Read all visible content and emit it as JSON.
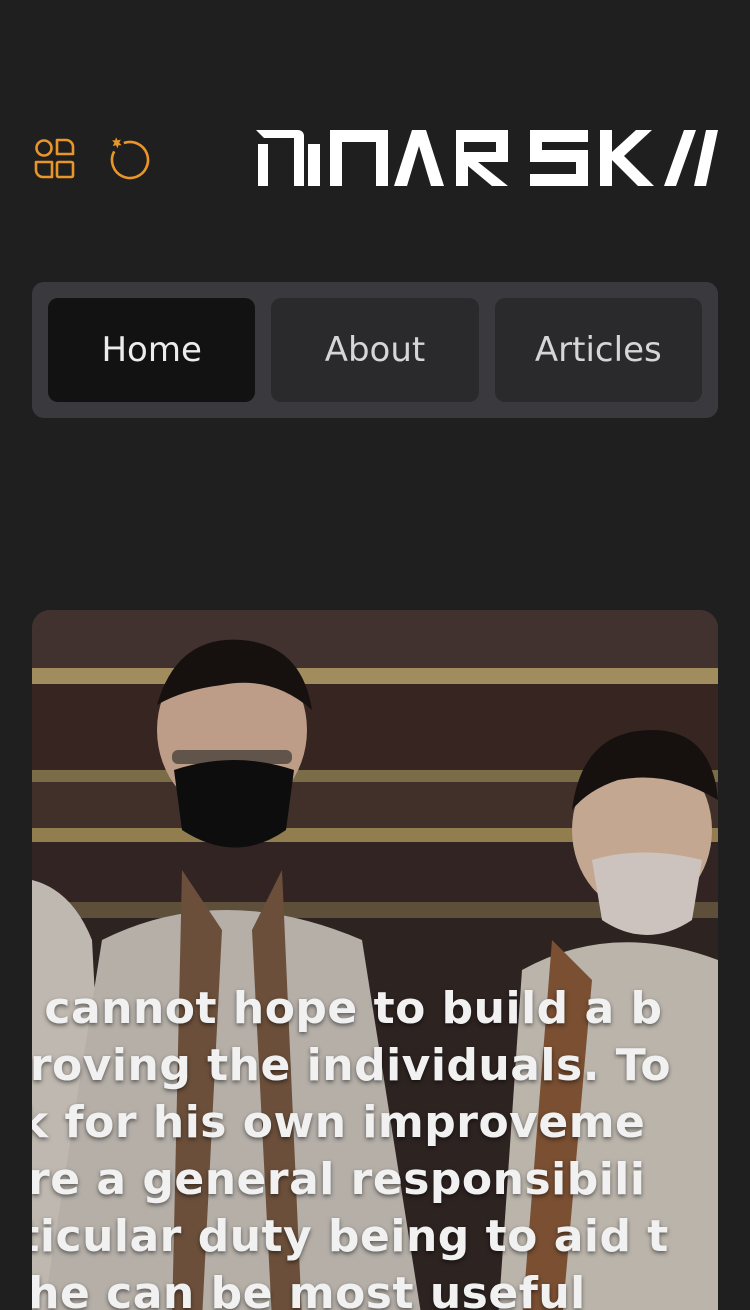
{
  "header": {
    "brand": "DINARSKI",
    "icons": [
      "apps-icon",
      "refresh-icon"
    ],
    "accent_color": "#e8962a"
  },
  "nav": {
    "tabs": [
      {
        "label": "Home",
        "active": true
      },
      {
        "label": "About",
        "active": false
      },
      {
        "label": "Articles",
        "active": false
      }
    ]
  },
  "hero": {
    "quote_lines": [
      "ou cannot hope to build a b",
      "nproving the individuals. To",
      "ork for his own improveme",
      "hare a general responsibili",
      "articular duty being to aid t",
      "m he can be most useful"
    ]
  }
}
